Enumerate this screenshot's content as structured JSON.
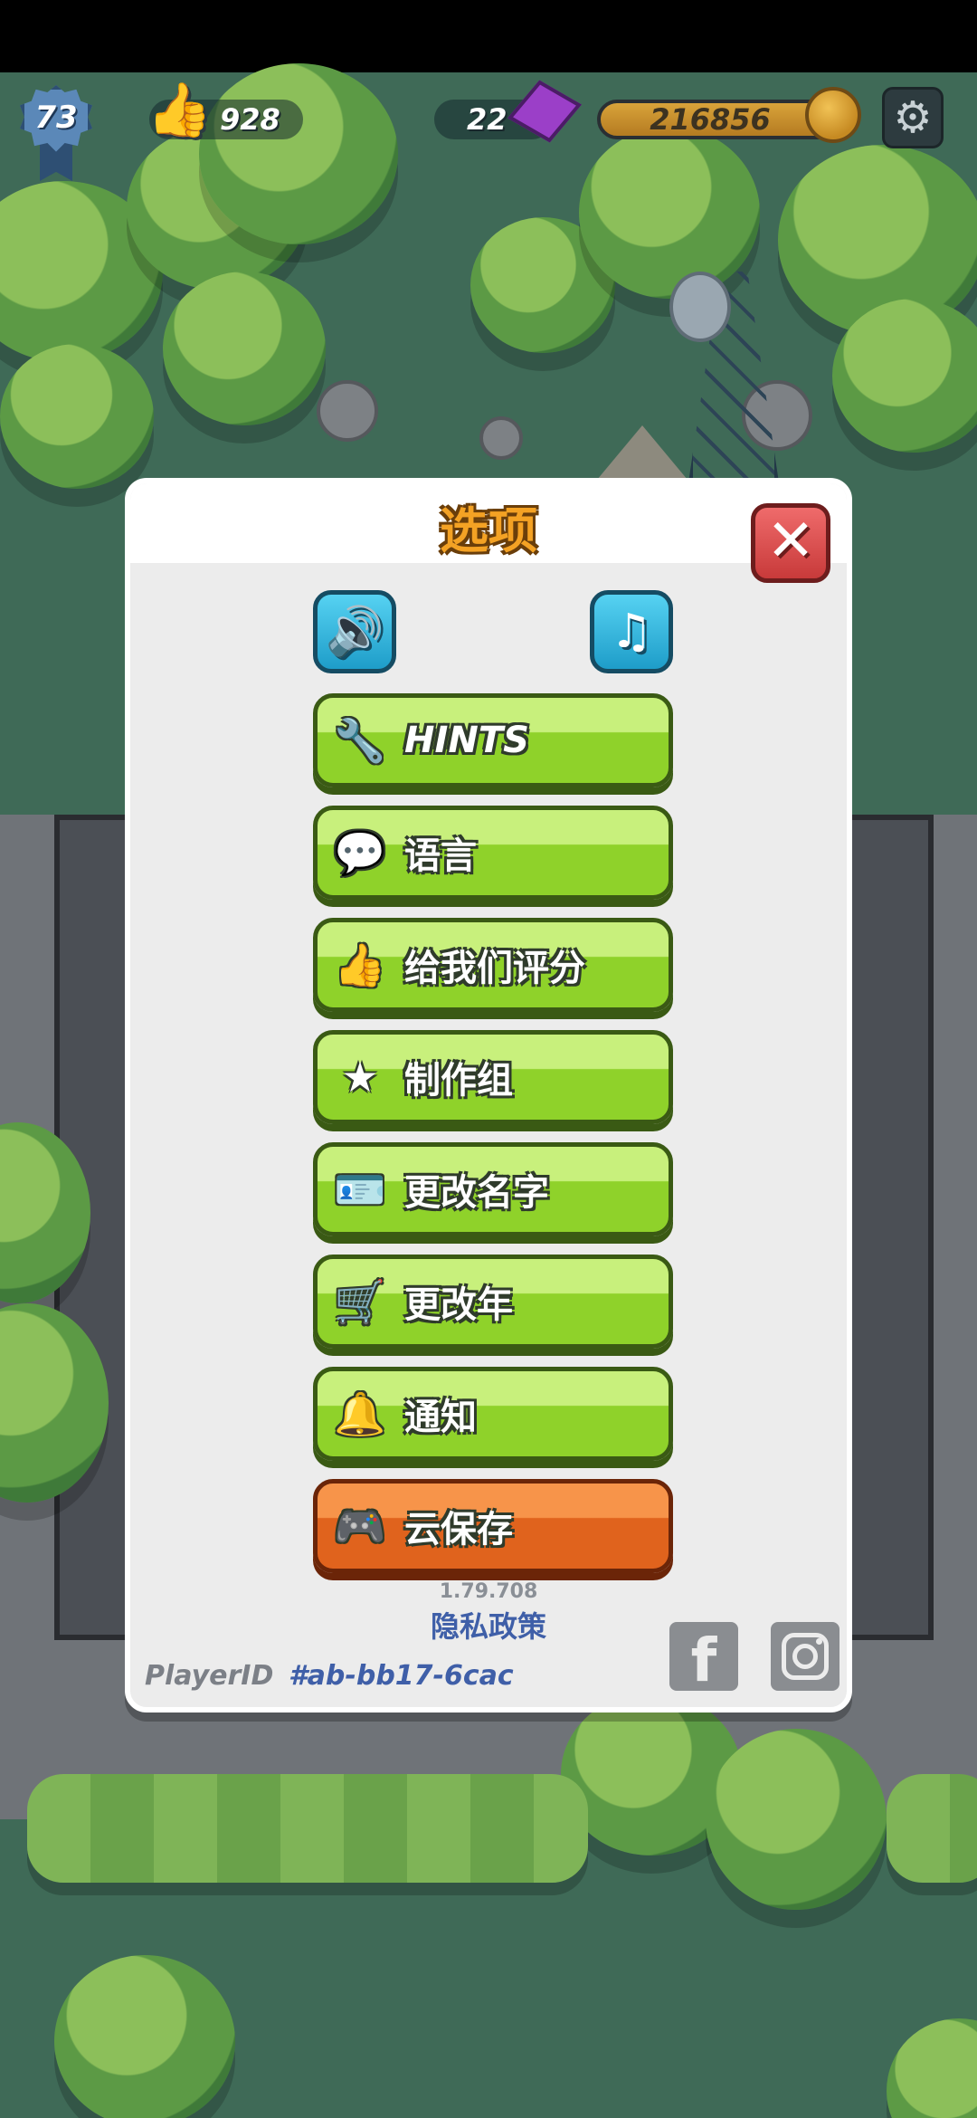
{
  "hud": {
    "level": "73",
    "likes": "928",
    "gems": "22",
    "coins": "216856"
  },
  "dialog": {
    "title": "选项",
    "menu": [
      {
        "label": "HINTS",
        "icon": "wrench-icon",
        "glyph": "🔧"
      },
      {
        "label": "语言",
        "icon": "chat-icon",
        "glyph": "💬"
      },
      {
        "label": "给我们评分",
        "icon": "thumbs-up-icon",
        "glyph": "👍"
      },
      {
        "label": "制作组",
        "icon": "star-icon",
        "glyph": "★"
      },
      {
        "label": "更改名字",
        "icon": "name-tag-icon",
        "glyph": "🪪"
      },
      {
        "label": "更改年",
        "icon": "stroller-icon",
        "glyph": "🛒"
      },
      {
        "label": "通知",
        "icon": "bell-icon",
        "glyph": "🔔"
      },
      {
        "label": "云保存",
        "icon": "gamepad-icon",
        "glyph": "🎮"
      }
    ],
    "version": "1.79.708",
    "privacy": "隐私政策",
    "player_id_label": "PlayerID",
    "player_id_value": "#ab-bb17-6cac"
  },
  "colors": {
    "menu_green": "#8fd22a",
    "menu_orange": "#e0631d",
    "title_orange": "#f4a224",
    "close_red": "#c83a3a",
    "toggle_blue": "#1e9dc9",
    "link_blue": "#3f5fa8"
  }
}
